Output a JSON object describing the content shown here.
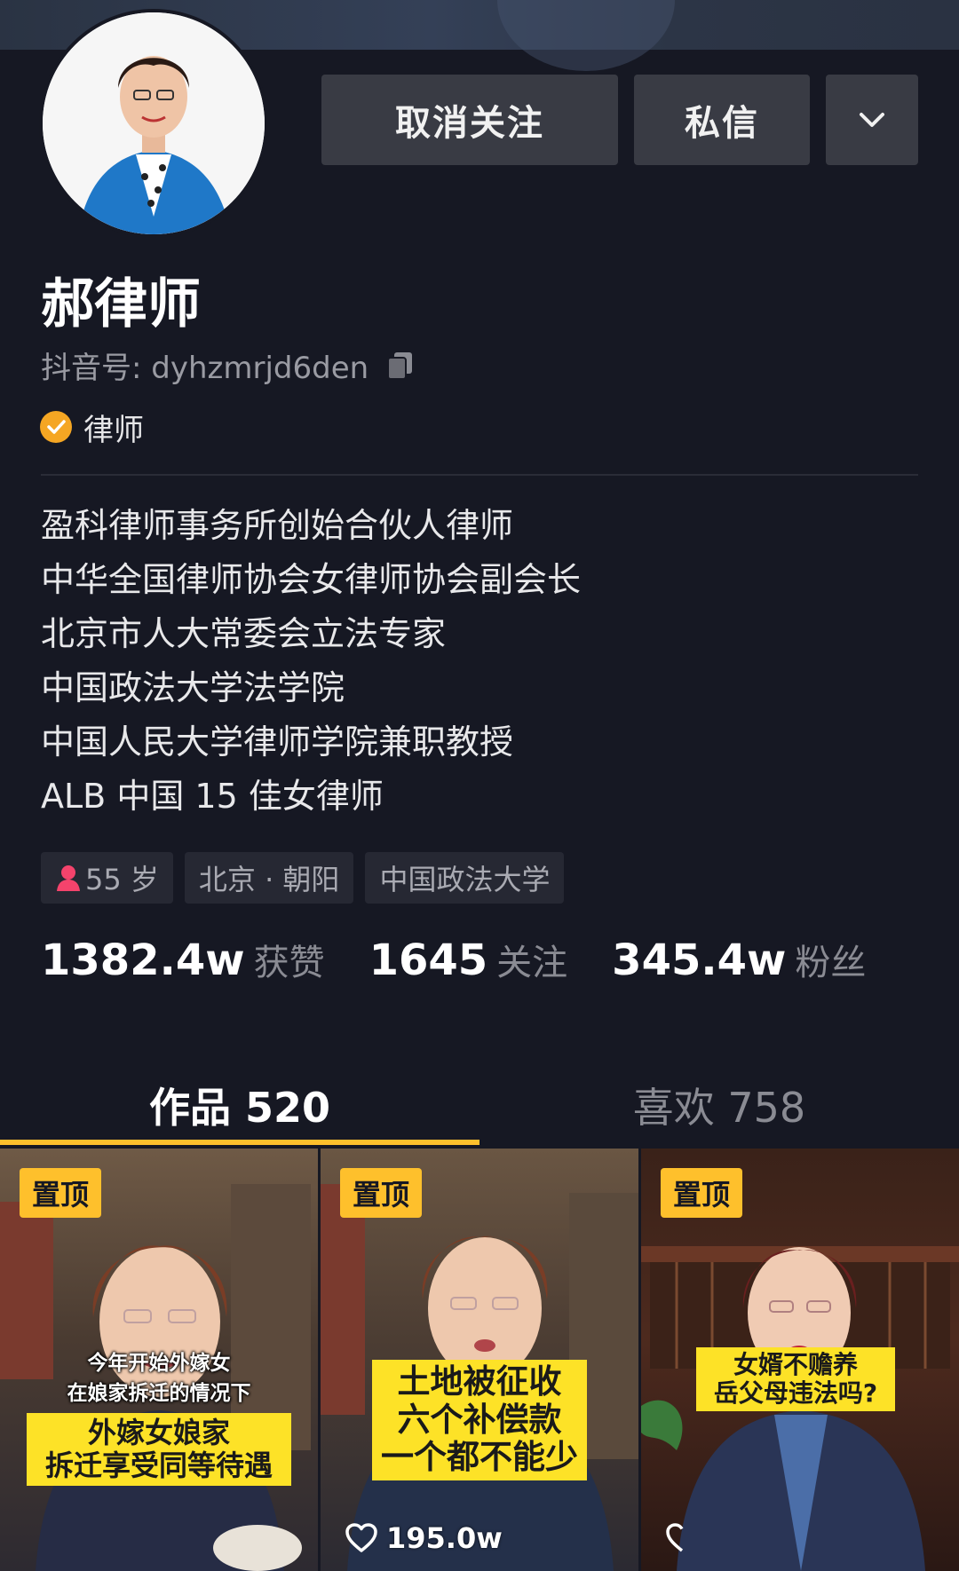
{
  "header": {
    "buttons": {
      "unfollow": "取消关注",
      "message": "私信",
      "more_icon": "chevron-down-icon"
    }
  },
  "profile": {
    "name": "郝律师",
    "douyin_id": "抖音号: dyhzmrjd6den",
    "copy_icon": "copy-icon",
    "verification": "律师",
    "verification_color": "#f5a623",
    "bio": [
      "盈科律师事务所创始合伙人律师",
      "中华全国律师协会女律师协会副会长",
      "北京市人大常委会立法专家",
      "中国政法大学法学院",
      "中国人民大学律师学院兼职教授",
      "ALB 中国 15 佳女律师"
    ],
    "tags": {
      "age": "55 岁",
      "location": "北京 · 朝阳",
      "school": "中国政法大学"
    },
    "stats": [
      {
        "value": "1382.4w",
        "label": "获赞"
      },
      {
        "value": "1645",
        "label": "关注"
      },
      {
        "value": "345.4w",
        "label": "粉丝"
      }
    ]
  },
  "tabs": {
    "works": "作品 520",
    "likes": "喜欢 758",
    "active": "works",
    "indicator_color": "#fec02c"
  },
  "videos": [
    {
      "pin": "置顶",
      "caption_small": [
        "今年开始外嫁女",
        "在娘家拆迁的情况下"
      ],
      "caption_box": [
        "外嫁女娘家",
        "拆迁享受同等待遇"
      ]
    },
    {
      "pin": "置顶",
      "caption_box": [
        "土地被征收",
        "六个补偿款",
        "一个都不能少"
      ],
      "likes": "195.0w"
    },
    {
      "pin": "置顶",
      "caption_box": [
        "女婿不赡养",
        "岳父母违法吗?"
      ]
    }
  ]
}
